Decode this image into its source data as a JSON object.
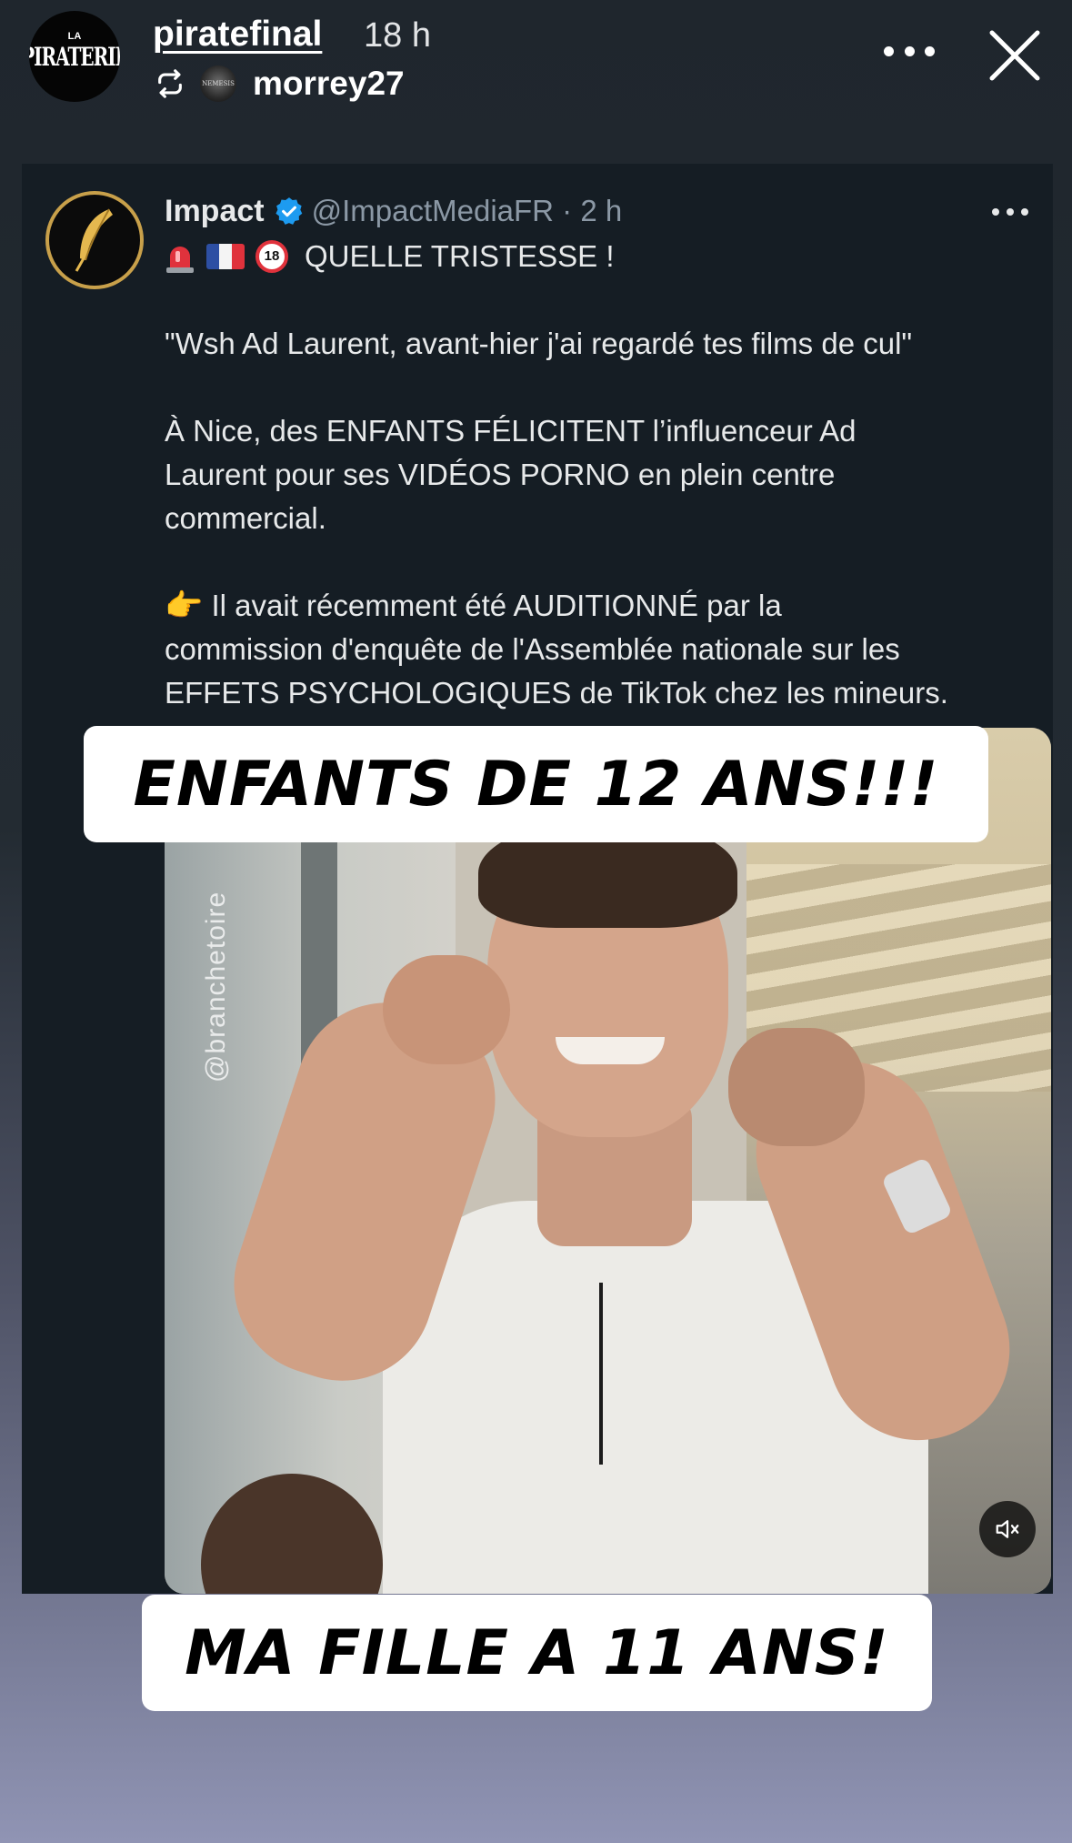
{
  "story": {
    "username": "piratefinal",
    "time": "18 h",
    "reposted_from": "morrey27",
    "avatar_logo_small": "LA",
    "avatar_logo_main": "PIRATERIE",
    "repost_avatar_text": "NEMESIS"
  },
  "tweet": {
    "name": "Impact",
    "handle_time": "@ImpactMediaFR · 2 h",
    "headline": "QUELLE TRISTESSE !",
    "quote": "\"Wsh Ad Laurent, avant-hier j'ai regardé tes films de cul\"",
    "para1_line1": "À Nice, des ENFANTS FÉLICITENT l’influenceur Ad",
    "para1_line2": "Laurent pour ses VIDÉOS PORNO en plein centre",
    "para1_line3": "commercial.",
    "para2_line1": "Il avait récemment été AUDITIONNÉ par la",
    "para2_line2": "commission d'enquête de l'Assemblée nationale sur les",
    "para2_line3": "EFFETS PSYCHOLOGIQUES de TikTok chez les mineurs.",
    "emoji_18": "18",
    "pointing_emoji": "👉"
  },
  "video": {
    "watermark": "@branchetoire"
  },
  "captions": {
    "top": "ENFANTS DE 12 ANS!!!",
    "bottom": "MA FILLE A 11 ANS!"
  },
  "colors": {
    "verified": "#1d9bf0",
    "gold": "#c8a04a",
    "tweet_bg": "#151d24"
  }
}
